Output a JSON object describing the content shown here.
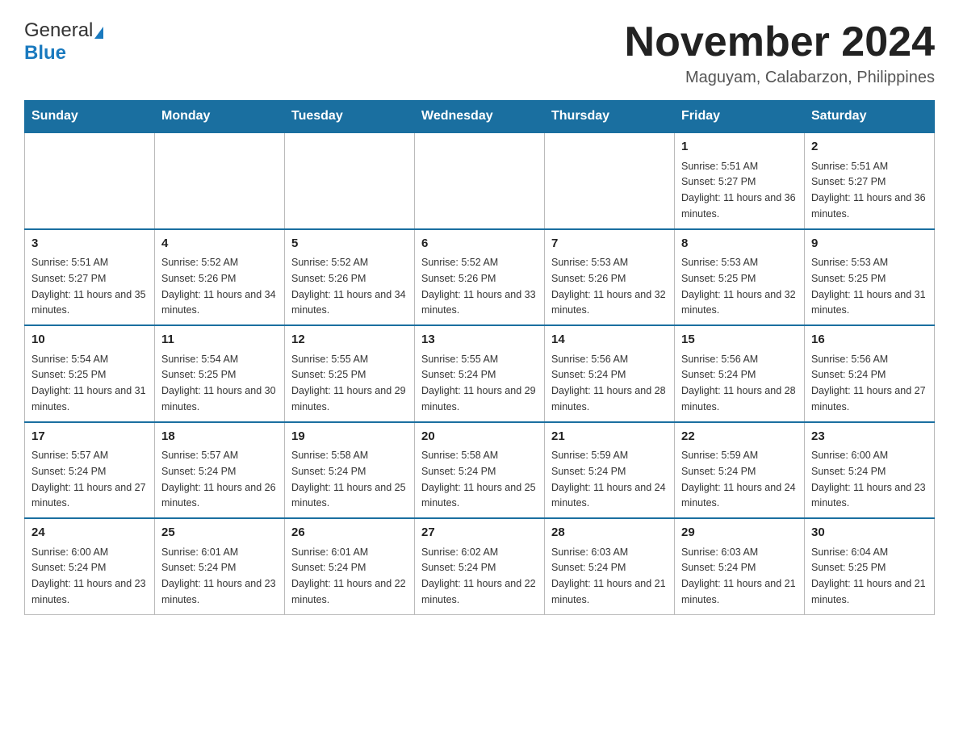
{
  "header": {
    "logo_general": "General",
    "logo_blue": "Blue",
    "month_title": "November 2024",
    "location": "Maguyam, Calabarzon, Philippines"
  },
  "calendar": {
    "days_of_week": [
      "Sunday",
      "Monday",
      "Tuesday",
      "Wednesday",
      "Thursday",
      "Friday",
      "Saturday"
    ],
    "weeks": [
      [
        {
          "day": "",
          "info": ""
        },
        {
          "day": "",
          "info": ""
        },
        {
          "day": "",
          "info": ""
        },
        {
          "day": "",
          "info": ""
        },
        {
          "day": "",
          "info": ""
        },
        {
          "day": "1",
          "info": "Sunrise: 5:51 AM\nSunset: 5:27 PM\nDaylight: 11 hours and 36 minutes."
        },
        {
          "day": "2",
          "info": "Sunrise: 5:51 AM\nSunset: 5:27 PM\nDaylight: 11 hours and 36 minutes."
        }
      ],
      [
        {
          "day": "3",
          "info": "Sunrise: 5:51 AM\nSunset: 5:27 PM\nDaylight: 11 hours and 35 minutes."
        },
        {
          "day": "4",
          "info": "Sunrise: 5:52 AM\nSunset: 5:26 PM\nDaylight: 11 hours and 34 minutes."
        },
        {
          "day": "5",
          "info": "Sunrise: 5:52 AM\nSunset: 5:26 PM\nDaylight: 11 hours and 34 minutes."
        },
        {
          "day": "6",
          "info": "Sunrise: 5:52 AM\nSunset: 5:26 PM\nDaylight: 11 hours and 33 minutes."
        },
        {
          "day": "7",
          "info": "Sunrise: 5:53 AM\nSunset: 5:26 PM\nDaylight: 11 hours and 32 minutes."
        },
        {
          "day": "8",
          "info": "Sunrise: 5:53 AM\nSunset: 5:25 PM\nDaylight: 11 hours and 32 minutes."
        },
        {
          "day": "9",
          "info": "Sunrise: 5:53 AM\nSunset: 5:25 PM\nDaylight: 11 hours and 31 minutes."
        }
      ],
      [
        {
          "day": "10",
          "info": "Sunrise: 5:54 AM\nSunset: 5:25 PM\nDaylight: 11 hours and 31 minutes."
        },
        {
          "day": "11",
          "info": "Sunrise: 5:54 AM\nSunset: 5:25 PM\nDaylight: 11 hours and 30 minutes."
        },
        {
          "day": "12",
          "info": "Sunrise: 5:55 AM\nSunset: 5:25 PM\nDaylight: 11 hours and 29 minutes."
        },
        {
          "day": "13",
          "info": "Sunrise: 5:55 AM\nSunset: 5:24 PM\nDaylight: 11 hours and 29 minutes."
        },
        {
          "day": "14",
          "info": "Sunrise: 5:56 AM\nSunset: 5:24 PM\nDaylight: 11 hours and 28 minutes."
        },
        {
          "day": "15",
          "info": "Sunrise: 5:56 AM\nSunset: 5:24 PM\nDaylight: 11 hours and 28 minutes."
        },
        {
          "day": "16",
          "info": "Sunrise: 5:56 AM\nSunset: 5:24 PM\nDaylight: 11 hours and 27 minutes."
        }
      ],
      [
        {
          "day": "17",
          "info": "Sunrise: 5:57 AM\nSunset: 5:24 PM\nDaylight: 11 hours and 27 minutes."
        },
        {
          "day": "18",
          "info": "Sunrise: 5:57 AM\nSunset: 5:24 PM\nDaylight: 11 hours and 26 minutes."
        },
        {
          "day": "19",
          "info": "Sunrise: 5:58 AM\nSunset: 5:24 PM\nDaylight: 11 hours and 25 minutes."
        },
        {
          "day": "20",
          "info": "Sunrise: 5:58 AM\nSunset: 5:24 PM\nDaylight: 11 hours and 25 minutes."
        },
        {
          "day": "21",
          "info": "Sunrise: 5:59 AM\nSunset: 5:24 PM\nDaylight: 11 hours and 24 minutes."
        },
        {
          "day": "22",
          "info": "Sunrise: 5:59 AM\nSunset: 5:24 PM\nDaylight: 11 hours and 24 minutes."
        },
        {
          "day": "23",
          "info": "Sunrise: 6:00 AM\nSunset: 5:24 PM\nDaylight: 11 hours and 23 minutes."
        }
      ],
      [
        {
          "day": "24",
          "info": "Sunrise: 6:00 AM\nSunset: 5:24 PM\nDaylight: 11 hours and 23 minutes."
        },
        {
          "day": "25",
          "info": "Sunrise: 6:01 AM\nSunset: 5:24 PM\nDaylight: 11 hours and 23 minutes."
        },
        {
          "day": "26",
          "info": "Sunrise: 6:01 AM\nSunset: 5:24 PM\nDaylight: 11 hours and 22 minutes."
        },
        {
          "day": "27",
          "info": "Sunrise: 6:02 AM\nSunset: 5:24 PM\nDaylight: 11 hours and 22 minutes."
        },
        {
          "day": "28",
          "info": "Sunrise: 6:03 AM\nSunset: 5:24 PM\nDaylight: 11 hours and 21 minutes."
        },
        {
          "day": "29",
          "info": "Sunrise: 6:03 AM\nSunset: 5:24 PM\nDaylight: 11 hours and 21 minutes."
        },
        {
          "day": "30",
          "info": "Sunrise: 6:04 AM\nSunset: 5:25 PM\nDaylight: 11 hours and 21 minutes."
        }
      ]
    ]
  }
}
